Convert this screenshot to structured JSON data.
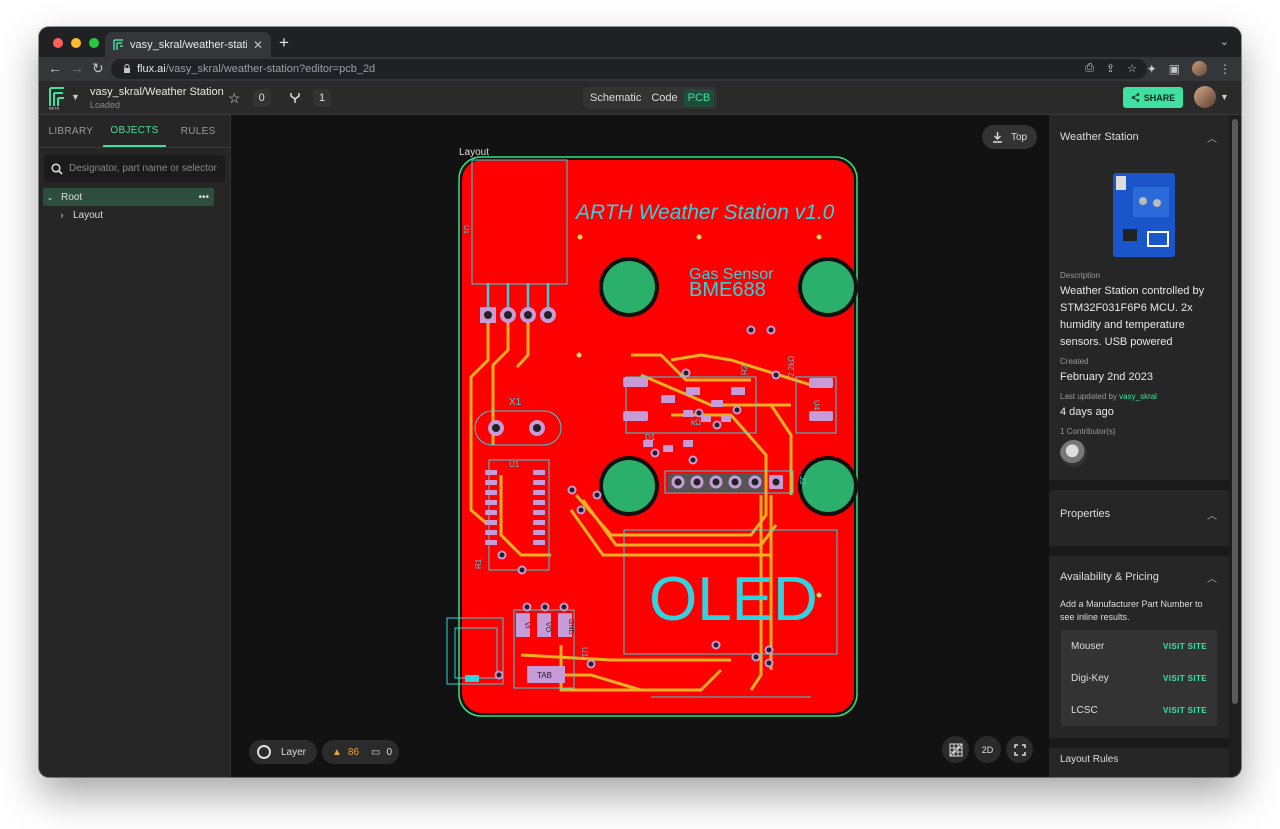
{
  "browser": {
    "tab_title": "vasy_skral/weather-station: W",
    "url_host": "flux.ai",
    "url_path": "/vasy_skral/weather-station?editor=pcb_2d"
  },
  "header": {
    "project_name": "vasy_skral/Weather Station",
    "project_status": "Loaded",
    "stars": "0",
    "forks": "1",
    "views": [
      "Schematic",
      "Code",
      "PCB"
    ],
    "active_view": "PCB",
    "share_label": "SHARE"
  },
  "left": {
    "tabs": [
      "LIBRARY",
      "OBJECTS",
      "RULES"
    ],
    "active_tab": "OBJECTS",
    "search_placeholder": "Designator, part name or selector",
    "tree": {
      "root": "Root",
      "child": "Layout"
    }
  },
  "canvas": {
    "top_label": "Top",
    "layer_label": "Layer",
    "warnings": "86",
    "comments": "0",
    "mode_label": "2D",
    "pcb": {
      "layout_label": "Layout",
      "title": "ARTH Weather Station v1.0",
      "sensor_line1": "Gas Sensor",
      "sensor_line2": "BME688",
      "oled": "OLED",
      "labels": {
        "u1": "U1",
        "x1": "X1",
        "u1b": "U1",
        "r1": "R1",
        "d1": "D1",
        "r2": "R2",
        "u4": "U4",
        "j3": "J3",
        "r_val": "2.2kΩ",
        "kohm": "kΩ",
        "vi": "VI",
        "vo": "VO",
        "gnd": "GND",
        "tab": "TAB",
        "u_reg": "U1"
      }
    }
  },
  "right": {
    "project_title": "Weather Station",
    "description_label": "Description",
    "description": "Weather Station controlled by STM32F031F6P6 MCU. 2x humidity and temperature sensors. USB powered",
    "created_label": "Created",
    "created": "February 2nd 2023",
    "updated_label": "Last updated by",
    "updated_by": "vasy_skral",
    "updated": "4 days ago",
    "contributors": "1 Contributor(s)",
    "properties_title": "Properties",
    "availability_title": "Availability & Pricing",
    "availability_note": "Add a Manufacturer Part Number to see inline results.",
    "distributors": [
      {
        "name": "Mouser",
        "action": "VISIT SITE"
      },
      {
        "name": "Digi-Key",
        "action": "VISIT SITE"
      },
      {
        "name": "LCSC",
        "action": "VISIT SITE"
      }
    ],
    "next_section": "Layout Rules"
  },
  "colors": {
    "accent": "#3fe0a0",
    "board_red": "#ff0000",
    "trace": "#f0b020",
    "silk": "#2fd3e0",
    "board_outline": "#35e07a",
    "warning": "#e8a33a"
  }
}
